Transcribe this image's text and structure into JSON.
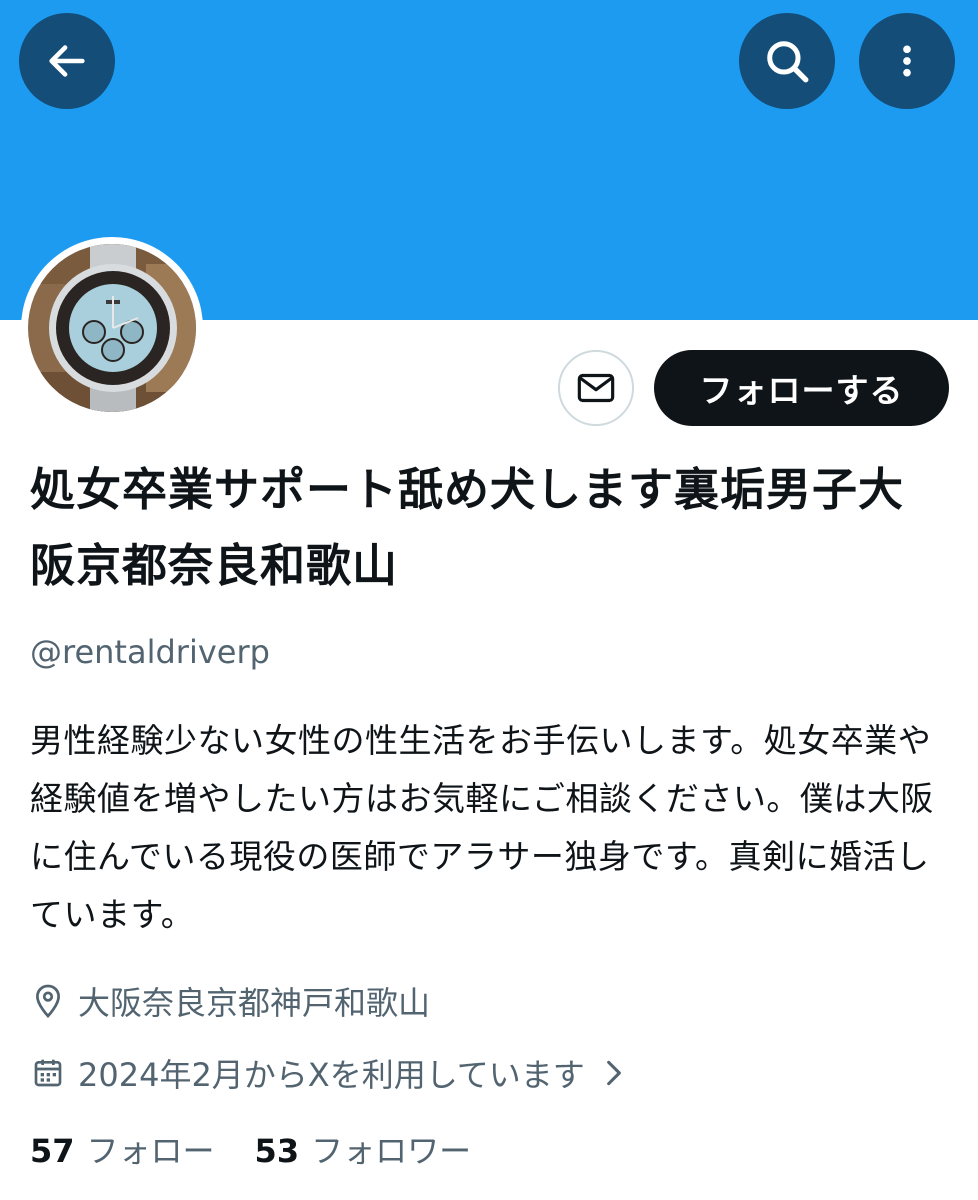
{
  "header": {
    "icons": {
      "back": "arrow-left-icon",
      "search": "search-icon",
      "more": "more-vertical-icon"
    },
    "banner_color": "#1d9bf0",
    "button_color": "#134d78"
  },
  "profile": {
    "avatar": "wristwatch-photo",
    "follow_label": "フォローする",
    "mail_icon": "envelope-icon",
    "display_name": "処女卒業サポート舐め犬します裏垢男子大阪京都奈良和歌山",
    "handle": "@rentaldriverp",
    "bio": "男性経験少ない女性の性生活をお手伝いします。処女卒業や経験値を増やしたい方はお気軽にご相談ください。僕は大阪に住んでいる現役の医師でアラサー独身です。真剣に婚活しています。",
    "location": "大阪奈良京都神戸和歌山",
    "joined": "2024年2月からXを利用しています"
  },
  "stats": {
    "following_count": "57",
    "following_label": "フォロー",
    "followers_count": "53",
    "followers_label": "フォロワー"
  },
  "colors": {
    "text_primary": "#0f1419",
    "text_secondary": "#536471",
    "button_dark": "#0f1419"
  }
}
